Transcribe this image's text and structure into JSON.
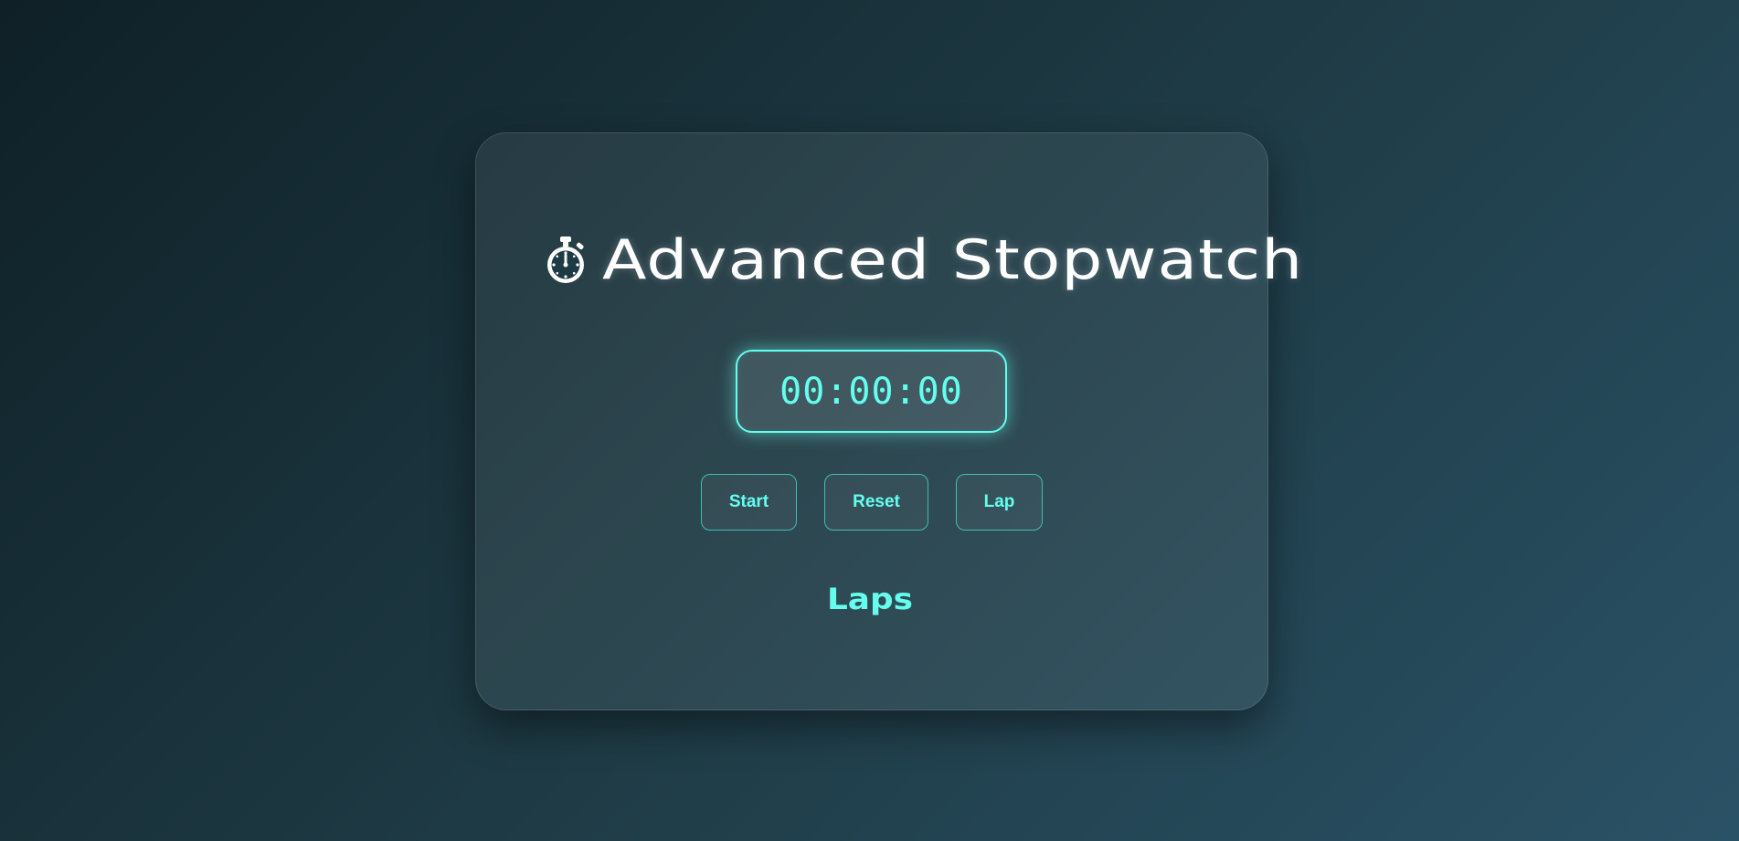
{
  "header": {
    "icon": "stopwatch-icon",
    "title": "Advanced Stopwatch"
  },
  "timer": {
    "display": "00:00:00"
  },
  "controls": {
    "start_label": "Start",
    "reset_label": "Reset",
    "lap_label": "Lap"
  },
  "laps": {
    "heading": "Laps",
    "items": []
  },
  "colors": {
    "accent": "#64ffef",
    "button_border": "#3fbfb3",
    "title_text": "#ffffff",
    "background_start": "#0f2027",
    "background_end": "#2a5266"
  }
}
